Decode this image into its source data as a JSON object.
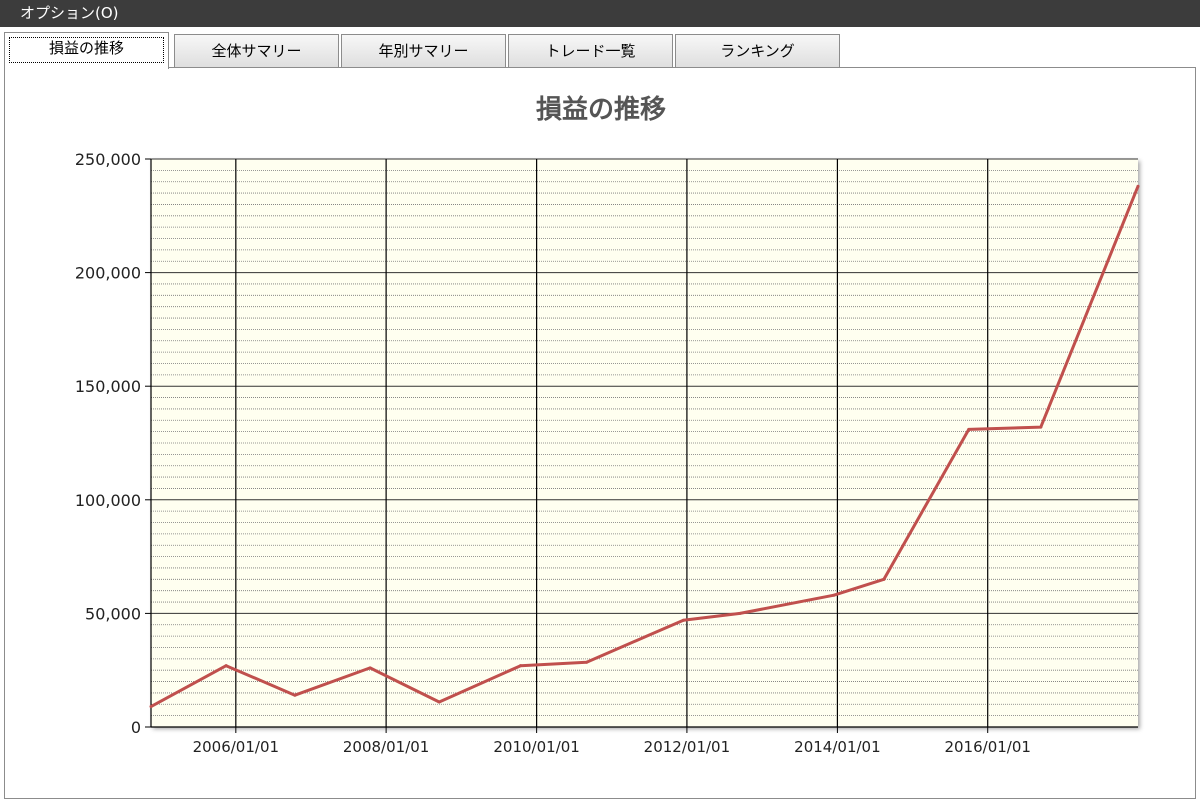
{
  "menu": {
    "options_label": "オプション(O)"
  },
  "tabs": [
    {
      "label": "損益の推移"
    },
    {
      "label": "全体サマリー"
    },
    {
      "label": "年別サマリー"
    },
    {
      "label": "トレード一覧"
    },
    {
      "label": "ランキング"
    }
  ],
  "chart_data": {
    "type": "line",
    "title": "損益の推移",
    "xlabel": "",
    "ylabel": "",
    "x_axis_type": "date",
    "xlim": [
      "2004-11-15",
      "2017-12-31"
    ],
    "ylim": [
      0,
      250000
    ],
    "y_major_ticks": [
      0,
      50000,
      100000,
      150000,
      200000,
      250000
    ],
    "y_tick_labels": [
      "0",
      "50,000",
      "100,000",
      "150,000",
      "200,000",
      "250,000"
    ],
    "y_minor_step": 5000,
    "x_ticks": [
      "2006-01-01",
      "2008-01-01",
      "2010-01-01",
      "2012-01-01",
      "2014-01-01",
      "2016-01-01"
    ],
    "x_tick_labels": [
      "2006/01/01",
      "2008/01/01",
      "2010/01/01",
      "2012/01/01",
      "2014/01/01",
      "2016/01/01"
    ],
    "grid": true,
    "legend": "none",
    "colors": {
      "plot_background": "#fffff0",
      "line": "#c0504d",
      "grid": "#000000"
    },
    "series": [
      {
        "x": [
          "2004-11-15",
          "2005-11-15",
          "2006-10-15",
          "2007-10-15",
          "2008-09-15",
          "2009-10-15",
          "2010-09-01",
          "2011-12-15",
          "2012-09-15",
          "2013-12-15",
          "2014-08-15",
          "2015-10-01",
          "2016-09-15",
          "2017-12-31"
        ],
        "values": [
          9000,
          27000,
          14000,
          26000,
          11000,
          27000,
          28500,
          47000,
          50000,
          58000,
          65000,
          131000,
          132000,
          238000
        ]
      }
    ]
  }
}
